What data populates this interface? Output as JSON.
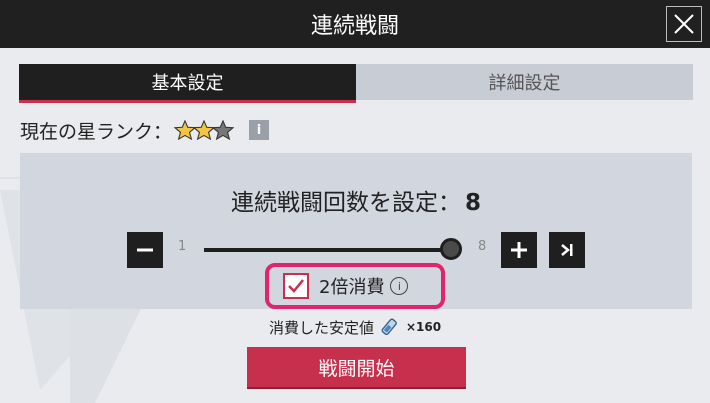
{
  "dialog": {
    "title": "連続戦闘"
  },
  "tabs": [
    {
      "label": "基本設定",
      "active": true
    },
    {
      "label": "詳細設定",
      "active": false
    }
  ],
  "rank": {
    "label": "現在の星ランク：",
    "stars_filled": 2,
    "stars_total": 3
  },
  "count": {
    "label": "連続戦闘回数を設定：",
    "value": "8"
  },
  "slider": {
    "min": "1",
    "max": "8",
    "value": 8
  },
  "double_consume": {
    "label": "2倍消費",
    "checked": true
  },
  "consume": {
    "label": "消費した安定値",
    "multiplier": "×160"
  },
  "start_button": {
    "label": "戦闘開始"
  },
  "colors": {
    "accent": "#c7304c",
    "highlight": "#e0246e",
    "dark": "#1f1f1f",
    "panel": "#d2d6de"
  }
}
